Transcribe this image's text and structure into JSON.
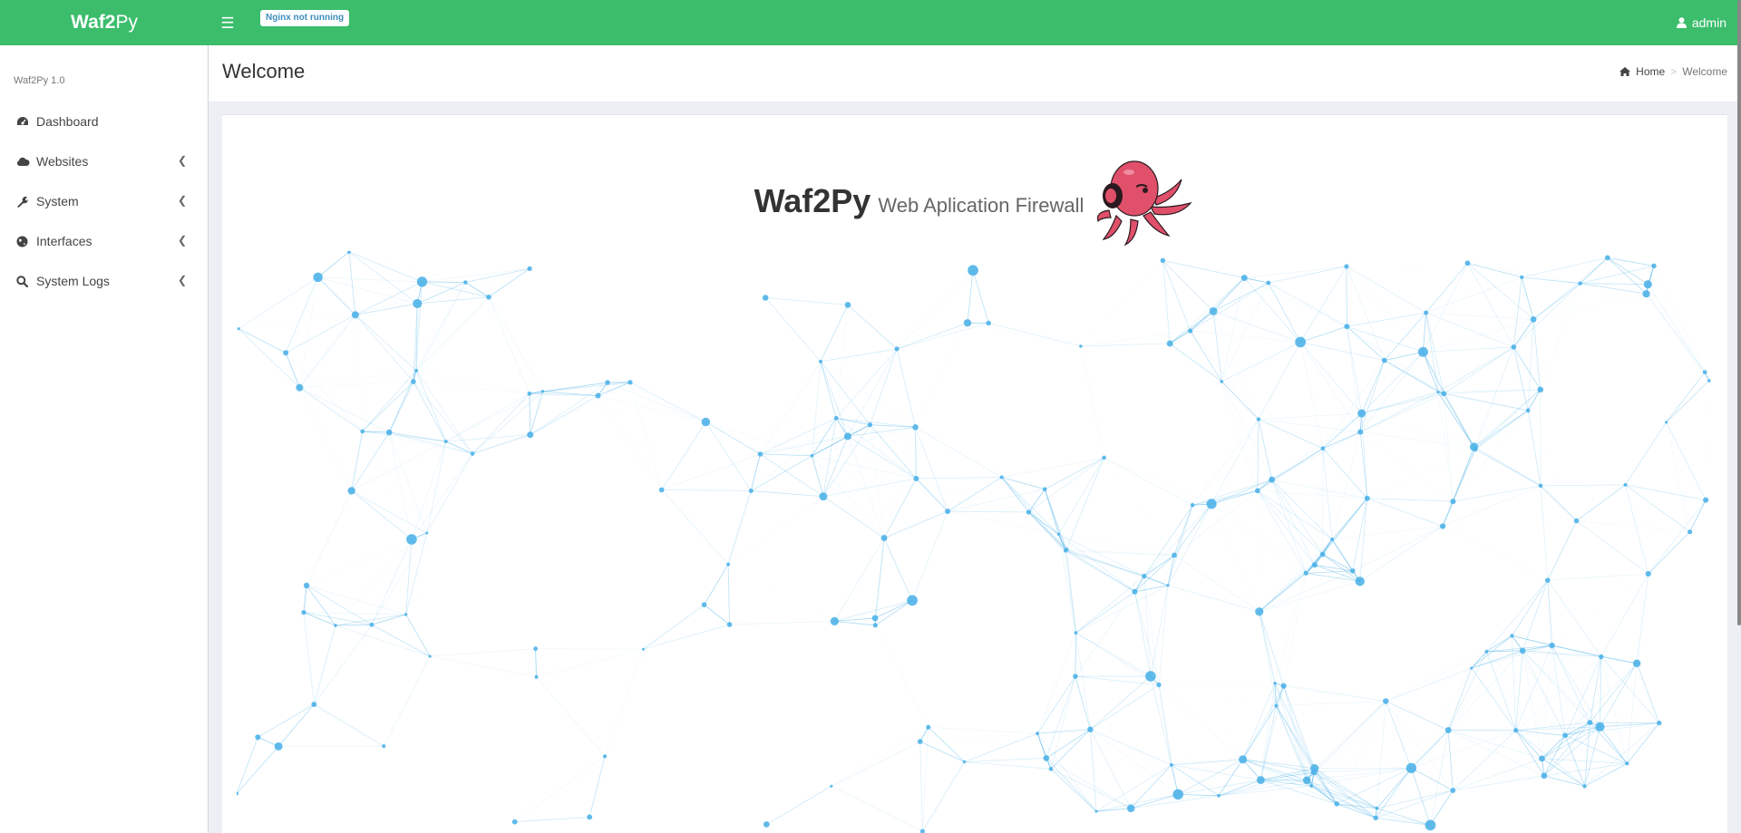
{
  "app": {
    "logo_bold": "Waf2",
    "logo_rest": "Py",
    "nginx_status": "Nginx not running",
    "user": "admin"
  },
  "sidebar": {
    "version": "Waf2Py 1.0",
    "items": [
      {
        "label": "Dashboard",
        "icon": "dashboard-icon"
      },
      {
        "label": "Websites",
        "icon": "cloud-icon"
      },
      {
        "label": "System",
        "icon": "wrench-icon"
      },
      {
        "label": "Interfaces",
        "icon": "globe-icon"
      },
      {
        "label": "System Logs",
        "icon": "search-icon"
      }
    ]
  },
  "header": {
    "title": "Welcome",
    "breadcrumb": {
      "home": "Home",
      "current": "Welcome"
    }
  },
  "hero": {
    "title": "Waf2Py",
    "subtitle": "Web Aplication Firewall"
  },
  "colors": {
    "topbar": "#3bbd6c",
    "network": "#4fb3e8",
    "mascot": "#e0506a"
  }
}
